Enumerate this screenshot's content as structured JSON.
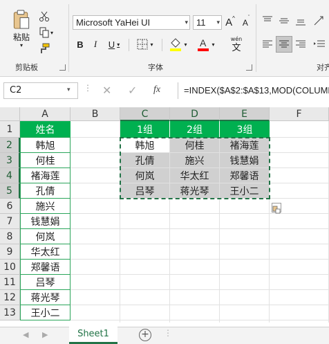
{
  "ribbon": {
    "paste_label": "粘贴",
    "clipboard_label": "剪贴板",
    "font_group_label": "字体",
    "align_group_partial": "对齐",
    "font_name": "Microsoft YaHei UI",
    "font_size": "11",
    "grow_label": "A",
    "shrink_label": "A",
    "bold_label": "B",
    "italic_label": "I",
    "underline_label": "U",
    "phonetic_top": "wén",
    "phonetic_bottom": "文",
    "fill_color": "#ffff00",
    "font_color": "#ff0000"
  },
  "formula_bar": {
    "name_box": "C2",
    "fx_label": "fx",
    "formula": "=INDEX($A$2:$A$13,MOD(COLUMN"
  },
  "sheet": {
    "columns": [
      "A",
      "B",
      "C",
      "D",
      "E",
      "F"
    ],
    "rows": [
      "1",
      "2",
      "3",
      "4",
      "5",
      "6",
      "7",
      "8",
      "9",
      "10",
      "11",
      "12",
      "13"
    ],
    "a_header": "姓名",
    "a_names": [
      "韩旭",
      "何桂",
      "褚海莲",
      "孔倩",
      "施兴",
      "钱慧娟",
      "何岚",
      "华太红",
      "郑馨语",
      "吕琴",
      "蒋光琴",
      "王小二"
    ],
    "group_headers": [
      "1组",
      "2组",
      "3组"
    ],
    "groups": [
      [
        "韩旭",
        "何桂",
        "褚海莲"
      ],
      [
        "孔倩",
        "施兴",
        "钱慧娟"
      ],
      [
        "何岚",
        "华太红",
        "郑馨语"
      ],
      [
        "吕琴",
        "蒋光琴",
        "王小二"
      ]
    ]
  },
  "tabs": {
    "sheet_name": "Sheet1",
    "add_label": "+"
  },
  "colors": {
    "header_green": "#00b050",
    "excel_green": "#217346",
    "selection_gray": "#d0d0d0"
  }
}
